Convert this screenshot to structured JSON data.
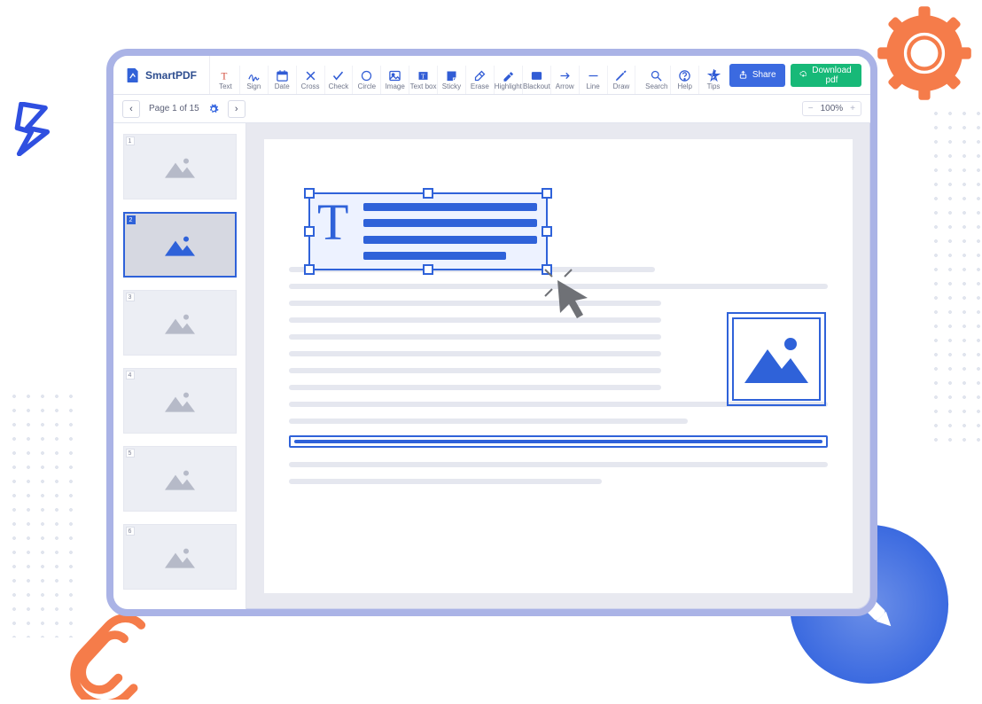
{
  "app": {
    "name": "SmartPDF"
  },
  "toolbar": {
    "tools": [
      {
        "id": "text",
        "label": "Text"
      },
      {
        "id": "sign",
        "label": "Sign"
      },
      {
        "id": "date",
        "label": "Date"
      },
      {
        "id": "cross",
        "label": "Cross"
      },
      {
        "id": "check",
        "label": "Check"
      },
      {
        "id": "circle",
        "label": "Circle"
      },
      {
        "id": "image",
        "label": "Image"
      },
      {
        "id": "textbox",
        "label": "Text box"
      },
      {
        "id": "sticky",
        "label": "Sticky"
      },
      {
        "id": "erase",
        "label": "Erase"
      },
      {
        "id": "highlight",
        "label": "Highlight"
      },
      {
        "id": "blackout",
        "label": "Blackout"
      },
      {
        "id": "arrow",
        "label": "Arrow"
      },
      {
        "id": "line",
        "label": "Line"
      },
      {
        "id": "draw",
        "label": "Draw"
      },
      {
        "id": "search",
        "label": "Search"
      },
      {
        "id": "help",
        "label": "Help"
      },
      {
        "id": "tips",
        "label": "Tips"
      }
    ],
    "share": "Share",
    "download": "Download pdf"
  },
  "pager": {
    "label": "Page 1 of 15"
  },
  "zoom": {
    "value": "100%"
  },
  "thumbs": {
    "count": 6,
    "active_index": 2,
    "labels": [
      "1",
      "2",
      "3",
      "4",
      "5",
      "6"
    ]
  },
  "colors": {
    "brand_blue": "#2f62d9",
    "accent_green": "#17b978",
    "accent_orange": "#f57c4a"
  }
}
